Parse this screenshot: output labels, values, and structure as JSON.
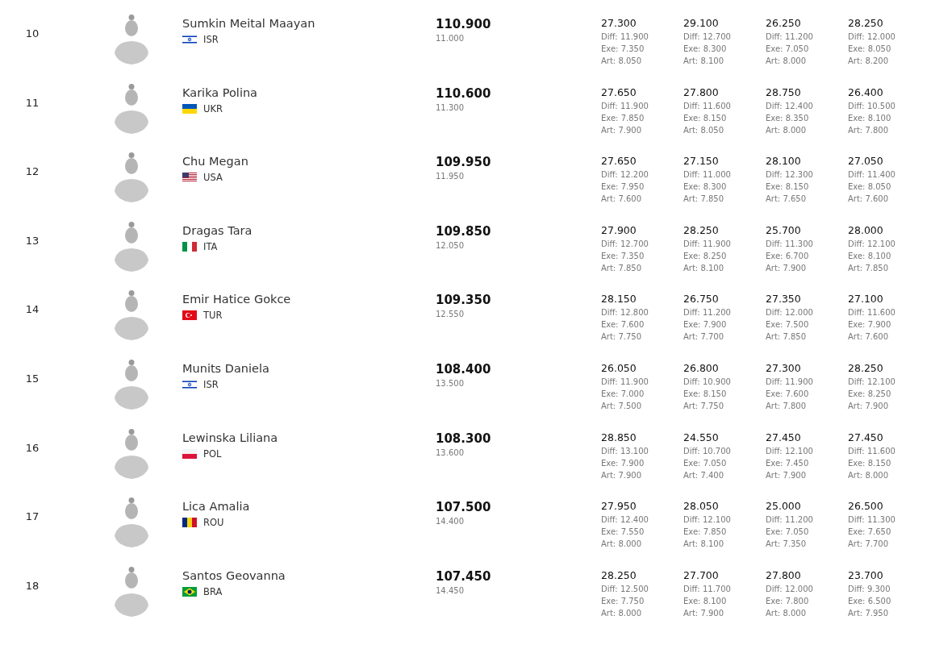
{
  "athletes": [
    {
      "rank": "10",
      "name": "Sumkin Meital Maayan",
      "flag": {
        "kind": "israel"
      },
      "country": "ISR",
      "total": "110.900",
      "gap": "11.000",
      "apparatus": [
        {
          "score": "27.300",
          "diff": "Diff: 11.900",
          "exe": "Exe: 7.350",
          "art": "Art: 8.050"
        },
        {
          "score": "29.100",
          "diff": "Diff: 12.700",
          "exe": "Exe: 8.300",
          "art": "Art: 8.100"
        },
        {
          "score": "26.250",
          "diff": "Diff: 11.200",
          "exe": "Exe: 7.050",
          "art": "Art: 8.000"
        },
        {
          "score": "28.250",
          "diff": "Diff: 12.000",
          "exe": "Exe: 8.050",
          "art": "Art: 8.200"
        }
      ]
    },
    {
      "rank": "11",
      "name": "Karika Polina",
      "flag": {
        "kind": "ukraine"
      },
      "country": "UKR",
      "total": "110.600",
      "gap": "11.300",
      "apparatus": [
        {
          "score": "27.650",
          "diff": "Diff: 11.900",
          "exe": "Exe: 7.850",
          "art": "Art: 7.900"
        },
        {
          "score": "27.800",
          "diff": "Diff: 11.600",
          "exe": "Exe: 8.150",
          "art": "Art: 8.050"
        },
        {
          "score": "28.750",
          "diff": "Diff: 12.400",
          "exe": "Exe: 8.350",
          "art": "Art: 8.000"
        },
        {
          "score": "26.400",
          "diff": "Diff: 10.500",
          "exe": "Exe: 8.100",
          "art": "Art: 7.800"
        }
      ]
    },
    {
      "rank": "12",
      "name": "Chu Megan",
      "flag": {
        "kind": "usa"
      },
      "country": "USA",
      "total": "109.950",
      "gap": "11.950",
      "apparatus": [
        {
          "score": "27.650",
          "diff": "Diff: 12.200",
          "exe": "Exe: 7.950",
          "art": "Art: 7.600"
        },
        {
          "score": "27.150",
          "diff": "Diff: 11.000",
          "exe": "Exe: 8.300",
          "art": "Art: 7.850"
        },
        {
          "score": "28.100",
          "diff": "Diff: 12.300",
          "exe": "Exe: 8.150",
          "art": "Art: 7.650"
        },
        {
          "score": "27.050",
          "diff": "Diff: 11.400",
          "exe": "Exe: 8.050",
          "art": "Art: 7.600"
        }
      ]
    },
    {
      "rank": "13",
      "name": "Dragas Tara",
      "flag": {
        "kind": "italy"
      },
      "country": "ITA",
      "total": "109.850",
      "gap": "12.050",
      "apparatus": [
        {
          "score": "27.900",
          "diff": "Diff: 12.700",
          "exe": "Exe: 7.350",
          "art": "Art: 7.850"
        },
        {
          "score": "28.250",
          "diff": "Diff: 11.900",
          "exe": "Exe: 8.250",
          "art": "Art: 8.100"
        },
        {
          "score": "25.700",
          "diff": "Diff: 11.300",
          "exe": "Exe: 6.700",
          "art": "Art: 7.900"
        },
        {
          "score": "28.000",
          "diff": "Diff: 12.100",
          "exe": "Exe: 8.100",
          "art": "Art: 7.850"
        }
      ]
    },
    {
      "rank": "14",
      "name": "Emir Hatice Gokce",
      "flag": {
        "kind": "turkey"
      },
      "country": "TUR",
      "total": "109.350",
      "gap": "12.550",
      "apparatus": [
        {
          "score": "28.150",
          "diff": "Diff: 12.800",
          "exe": "Exe: 7.600",
          "art": "Art: 7.750"
        },
        {
          "score": "26.750",
          "diff": "Diff: 11.200",
          "exe": "Exe: 7.900",
          "art": "Art: 7.700"
        },
        {
          "score": "27.350",
          "diff": "Diff: 12.000",
          "exe": "Exe: 7.500",
          "art": "Art: 7.850"
        },
        {
          "score": "27.100",
          "diff": "Diff: 11.600",
          "exe": "Exe: 7.900",
          "art": "Art: 7.600"
        }
      ]
    },
    {
      "rank": "15",
      "name": "Munits Daniela",
      "flag": {
        "kind": "israel"
      },
      "country": "ISR",
      "total": "108.400",
      "gap": "13.500",
      "apparatus": [
        {
          "score": "26.050",
          "diff": "Diff: 11.900",
          "exe": "Exe: 7.000",
          "art": "Art: 7.500"
        },
        {
          "score": "26.800",
          "diff": "Diff: 10.900",
          "exe": "Exe: 8.150",
          "art": "Art: 7.750"
        },
        {
          "score": "27.300",
          "diff": "Diff: 11.900",
          "exe": "Exe: 7.600",
          "art": "Art: 7.800"
        },
        {
          "score": "28.250",
          "diff": "Diff: 12.100",
          "exe": "Exe: 8.250",
          "art": "Art: 7.900"
        }
      ]
    },
    {
      "rank": "16",
      "name": "Lewinska Liliana",
      "flag": {
        "kind": "poland"
      },
      "country": "POL",
      "total": "108.300",
      "gap": "13.600",
      "apparatus": [
        {
          "score": "28.850",
          "diff": "Diff: 13.100",
          "exe": "Exe: 7.900",
          "art": "Art: 7.900"
        },
        {
          "score": "24.550",
          "diff": "Diff: 10.700",
          "exe": "Exe: 7.050",
          "art": "Art: 7.400"
        },
        {
          "score": "27.450",
          "diff": "Diff: 12.100",
          "exe": "Exe: 7.450",
          "art": "Art: 7.900"
        },
        {
          "score": "27.450",
          "diff": "Diff: 11.600",
          "exe": "Exe: 8.150",
          "art": "Art: 8.000"
        }
      ]
    },
    {
      "rank": "17",
      "name": "Lica Amalia",
      "flag": {
        "kind": "romania"
      },
      "country": "ROU",
      "total": "107.500",
      "gap": "14.400",
      "apparatus": [
        {
          "score": "27.950",
          "diff": "Diff: 12.400",
          "exe": "Exe: 7.550",
          "art": "Art: 8.000"
        },
        {
          "score": "28.050",
          "diff": "Diff: 12.100",
          "exe": "Exe: 7.850",
          "art": "Art: 8.100"
        },
        {
          "score": "25.000",
          "diff": "Diff: 11.200",
          "exe": "Exe: 7.050",
          "art": "Art: 7.350"
        },
        {
          "score": "26.500",
          "diff": "Diff: 11.300",
          "exe": "Exe: 7.650",
          "art": "Art: 7.700"
        }
      ]
    },
    {
      "rank": "18",
      "name": "Santos Geovanna",
      "flag": {
        "kind": "brazil"
      },
      "country": "BRA",
      "total": "107.450",
      "gap": "14.450",
      "apparatus": [
        {
          "score": "28.250",
          "diff": "Diff: 12.500",
          "exe": "Exe: 7.750",
          "art": "Art: 8.000"
        },
        {
          "score": "27.700",
          "diff": "Diff: 11.700",
          "exe": "Exe: 8.100",
          "art": "Art: 7.900"
        },
        {
          "score": "27.800",
          "diff": "Diff: 12.000",
          "exe": "Exe: 7.800",
          "art": "Art: 8.000"
        },
        {
          "score": "23.700",
          "diff": "Diff: 9.300",
          "exe": "Exe: 6.500",
          "art": "Art: 7.950"
        }
      ]
    }
  ]
}
